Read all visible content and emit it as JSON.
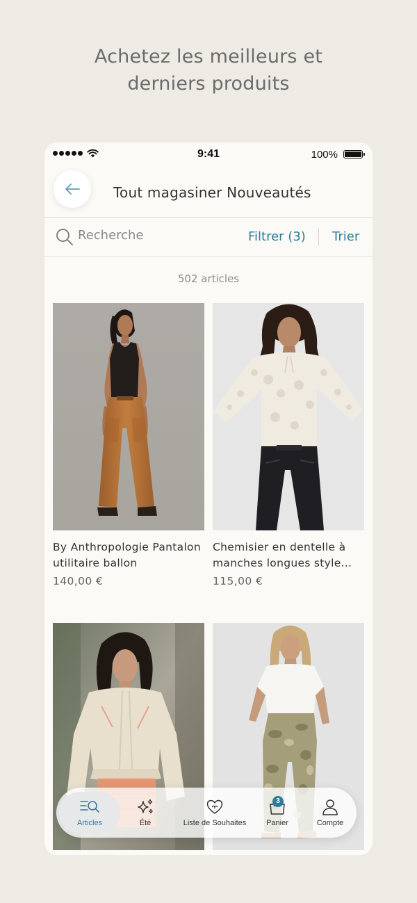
{
  "headline": {
    "line1": "Achetez les meilleurs et",
    "line2": "derniers produits"
  },
  "status_bar": {
    "time": "9:41",
    "battery": "100%"
  },
  "nav": {
    "title": "Tout magasiner Nouveautés"
  },
  "search": {
    "placeholder": "Recherche",
    "filter_label": "Filtrer (3)",
    "sort_label": "Trier"
  },
  "results": {
    "count": "502 articles"
  },
  "products": [
    {
      "name": "By Anthropologie Pantalon utilitaire ballon",
      "price": "140,00 €"
    },
    {
      "name": "Chemisier en dentelle à manches longues style...",
      "price": "115,00 €"
    },
    {
      "name": "",
      "price": ""
    },
    {
      "name": "",
      "price": ""
    }
  ],
  "tab_bar": {
    "items": [
      {
        "label": "Articles",
        "icon": "articles-search-icon",
        "active": true
      },
      {
        "label": "Été",
        "icon": "sparkles-icon",
        "active": false
      },
      {
        "label": "Liste de Souhaites",
        "icon": "heart-icon",
        "active": false
      },
      {
        "label": "Panier",
        "icon": "bag-icon",
        "active": false,
        "badge": "3"
      },
      {
        "label": "Compte",
        "icon": "person-icon",
        "active": false
      }
    ]
  },
  "colors": {
    "accent": "#2b7d9b",
    "background": "#eeeae4",
    "screen": "#fbfaf6"
  }
}
